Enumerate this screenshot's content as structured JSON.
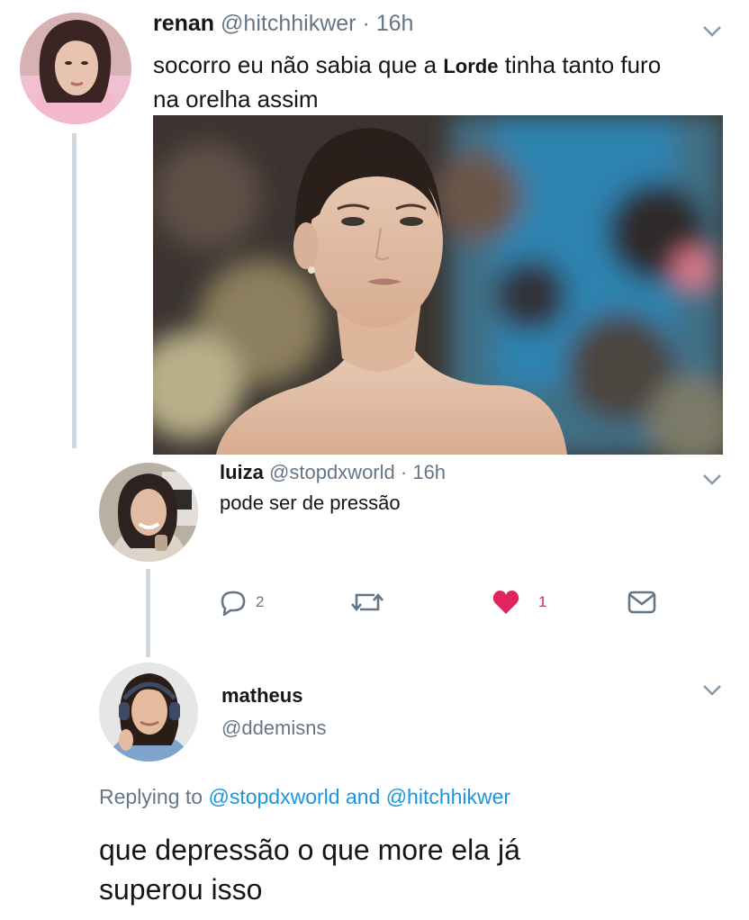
{
  "tweets": [
    {
      "name": "renan",
      "handle": "@hitchhikwer",
      "time": "· 16h",
      "text_part1": "socorro eu não sabia que a",
      "text_highlight": "Lorde",
      "text_part2": "tinha tanto furo",
      "text_line2": "na orelha assim"
    },
    {
      "name": "luiza",
      "handle": "@stopdxworld",
      "time": "· 16h",
      "text": "pode ser de pressão",
      "actions": {
        "replies": "2",
        "likes": "1"
      }
    },
    {
      "name": "matheus",
      "handle": "@ddemisns",
      "replying_prefix": "Replying to",
      "reply_user1": "@stopdxworld",
      "reply_and": "and",
      "reply_user2": "@hitchhikwer",
      "text_line1": "que depressão o que more ela já",
      "text_line2": "superou isso"
    }
  ],
  "colors": {
    "link": "#1b95e0",
    "like": "#e0245e",
    "muted": "#657786"
  }
}
